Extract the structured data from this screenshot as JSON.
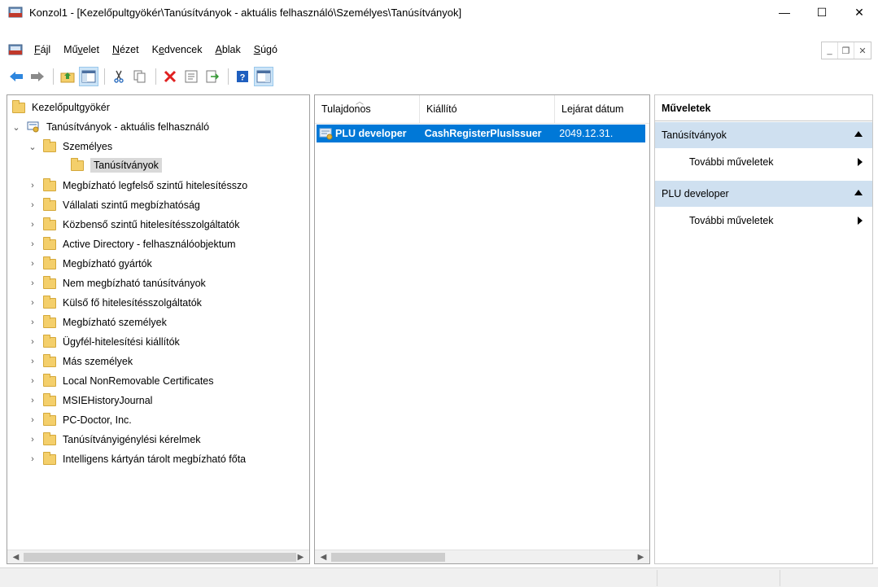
{
  "window": {
    "title": "Konzol1 - [Kezelőpultgyökér\\Tanúsítványok - aktuális felhasználó\\Személyes\\Tanúsítványok]",
    "minimize": "—",
    "maximize": "☐",
    "close": "✕"
  },
  "menu": {
    "items": [
      {
        "pre": "",
        "u": "F",
        "post": "ájl"
      },
      {
        "pre": "Mű",
        "u": "v",
        "post": "elet"
      },
      {
        "pre": "",
        "u": "N",
        "post": "ézet"
      },
      {
        "pre": "K",
        "u": "e",
        "post": "dvencek"
      },
      {
        "pre": "",
        "u": "A",
        "post": "blak"
      },
      {
        "pre": "",
        "u": "S",
        "post": "úgó"
      }
    ],
    "mdi_minimize": "_",
    "mdi_restore": "❐",
    "mdi_close": "✕"
  },
  "toolbar": {
    "icons": [
      "back-arrow-icon",
      "forward-arrow-icon",
      "up-folder-icon",
      "show-hide-tree-icon",
      "cut-icon",
      "copy-icon",
      "delete-icon",
      "properties-icon",
      "export-list-icon",
      "help-icon",
      "show-action-pane-icon"
    ]
  },
  "tree": {
    "root": "Kezelőpultgyökér",
    "store": "Tanúsítványok - aktuális felhasználó",
    "personal": "Személyes",
    "certificates": "Tanúsítványok",
    "folders": [
      "Megbízható legfelső szintű hitelesítésszo",
      "Vállalati szintű megbízhatóság",
      "Közbenső szintű hitelesítésszolgáltatók",
      "Active Directory - felhasználóobjektum",
      "Megbízható gyártók",
      "Nem megbízható tanúsítványok",
      "Külső fő hitelesítésszolgáltatók",
      "Megbízható személyek",
      "Ügyfél-hitelesítési kiállítók",
      "Más személyek",
      "Local NonRemovable Certificates",
      "MSIEHistoryJournal",
      "PC-Doctor, Inc.",
      "Tanúsítványigénylési kérelmek",
      "Intelligens kártyán tárolt megbízható főta"
    ]
  },
  "list": {
    "columns": [
      "Tulajdonos",
      "Kiállító",
      "Lejárat dátum"
    ],
    "rows": [
      {
        "owner": "PLU developer",
        "issuer": "CashRegisterPlusIssuer",
        "expires": "2049.12.31."
      }
    ]
  },
  "actions": {
    "title": "Műveletek",
    "sections": [
      {
        "header": "Tanúsítványok",
        "item": "További műveletek"
      },
      {
        "header": "PLU developer",
        "item": "További műveletek"
      }
    ]
  }
}
